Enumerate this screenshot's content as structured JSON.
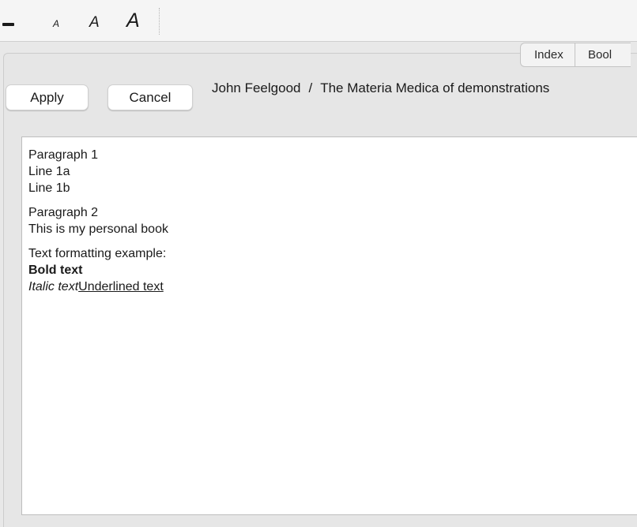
{
  "toolbar": {
    "font_size_small_label": "A",
    "font_size_medium_label": "A",
    "font_size_large_label": "A"
  },
  "tabs": [
    {
      "label": "Index"
    },
    {
      "label": "Bool"
    }
  ],
  "actions": {
    "apply_label": "Apply",
    "cancel_label": "Cancel"
  },
  "path": {
    "author": "John Feelgood",
    "separator": "/",
    "book": "The Materia Medica of demonstrations"
  },
  "editor": {
    "paragraph1": {
      "title": "Paragraph 1",
      "line_a": "Line 1a",
      "line_b": "Line 1b"
    },
    "paragraph2": {
      "title": "Paragraph 2",
      "body": "This is my personal book"
    },
    "formatting": {
      "heading": "Text formatting example:",
      "bold": "Bold text",
      "italic": "Italic text",
      "underlined": "Underlined text"
    }
  },
  "colors": {
    "window_bg": "#e8e8e8",
    "toolbar_bg": "#f5f5f5",
    "editor_bg": "#ffffff",
    "text": "#1a1a1a"
  }
}
